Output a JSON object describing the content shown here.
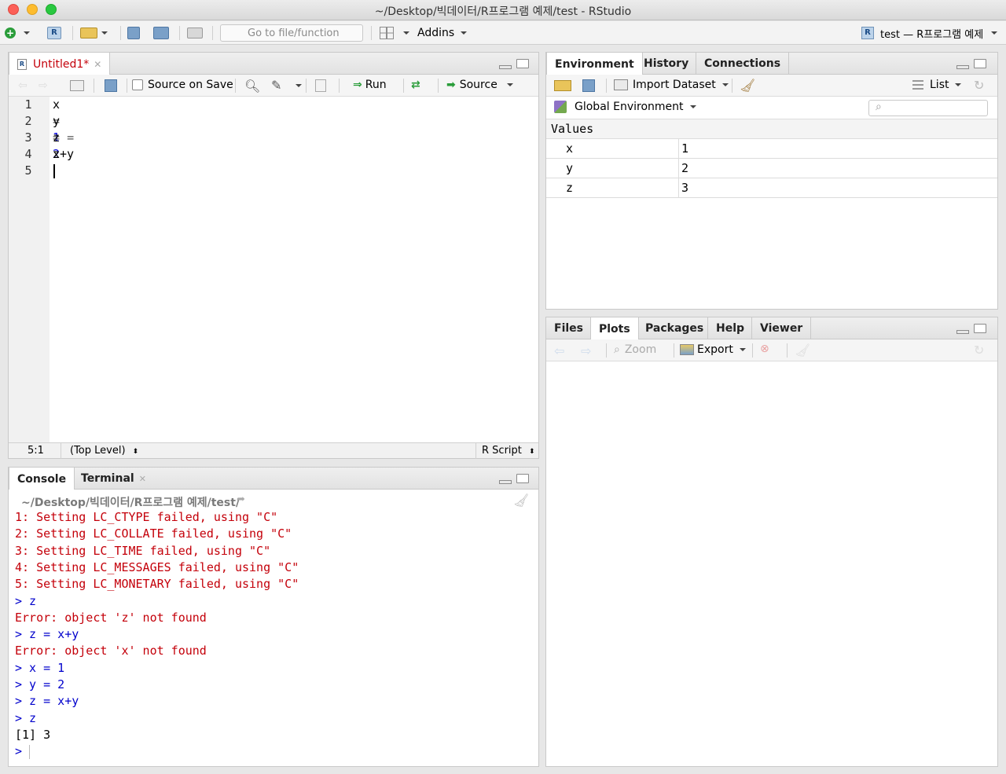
{
  "window": {
    "title": "~/Desktop/빅데이터/R프로그램 예제/test - RStudio"
  },
  "toolbar": {
    "goto_placeholder": "Go to file/function",
    "addins_label": "Addins",
    "project_label": "test — R프로그램 예제"
  },
  "editor": {
    "tab_label": "Untitled1*",
    "source_on_save_label": "Source on Save",
    "run_label": "Run",
    "source_label": "Source",
    "lines": [
      {
        "n": "1",
        "text": "x = 1"
      },
      {
        "n": "2",
        "text": "y = 2"
      },
      {
        "n": "3",
        "text": "z = x+y"
      },
      {
        "n": "4",
        "text": "z"
      },
      {
        "n": "5",
        "text": ""
      }
    ],
    "status": {
      "position": "5:1",
      "scope": "(Top Level)",
      "filetype": "R Script"
    }
  },
  "console": {
    "tabs": [
      "Console",
      "Terminal"
    ],
    "path": "~/Desktop/빅데이터/R프로그램 예제/test/",
    "lines": [
      {
        "text": "1: Setting LC_CTYPE failed, using \"C\"",
        "type": "error"
      },
      {
        "text": "2: Setting LC_COLLATE failed, using \"C\"",
        "type": "error"
      },
      {
        "text": "3: Setting LC_TIME failed, using \"C\"",
        "type": "error"
      },
      {
        "text": "4: Setting LC_MESSAGES failed, using \"C\"",
        "type": "error"
      },
      {
        "text": "5: Setting LC_MONETARY failed, using \"C\"",
        "type": "error"
      },
      {
        "text": "> z",
        "type": "input"
      },
      {
        "text": "Error: object 'z' not found",
        "type": "error"
      },
      {
        "text": "> z = x+y",
        "type": "input"
      },
      {
        "text": "Error: object 'x' not found",
        "type": "error"
      },
      {
        "text": "> x = 1",
        "type": "input"
      },
      {
        "text": "> y = 2",
        "type": "input"
      },
      {
        "text": "> z = x+y",
        "type": "input"
      },
      {
        "text": "> z",
        "type": "input"
      },
      {
        "text": "[1] 3",
        "type": "output"
      },
      {
        "text": ">",
        "type": "input"
      }
    ]
  },
  "environment": {
    "tabs": [
      "Environment",
      "History",
      "Connections"
    ],
    "import_label": "Import Dataset",
    "list_label": "List",
    "scope_label": "Global Environment",
    "section_label": "Values",
    "values": [
      {
        "name": "x",
        "value": "1"
      },
      {
        "name": "y",
        "value": "2"
      },
      {
        "name": "z",
        "value": "3"
      }
    ]
  },
  "files": {
    "tabs": [
      "Files",
      "Plots",
      "Packages",
      "Help",
      "Viewer"
    ],
    "zoom_label": "Zoom",
    "export_label": "Export"
  }
}
